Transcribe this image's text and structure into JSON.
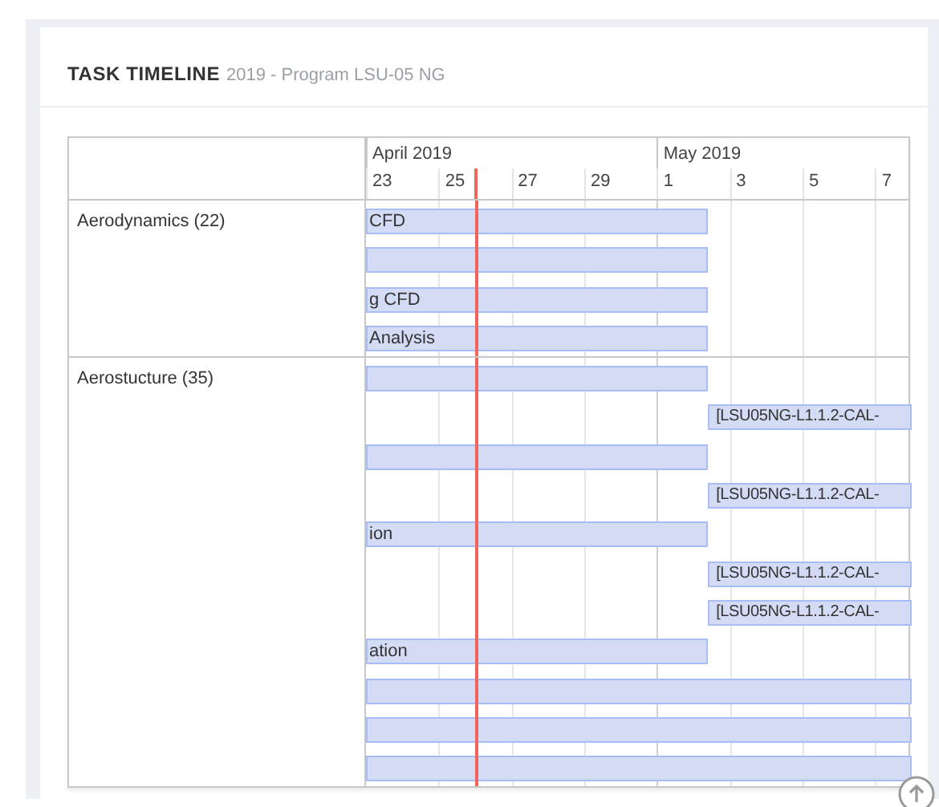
{
  "card": {
    "title": "TASK TIMELINE",
    "subtitle": "2019 - Program LSU-05 NG"
  },
  "timeline": {
    "months": [
      {
        "label": "April 2019",
        "days": [
          {
            "label": "23",
            "today": false
          },
          {
            "label": "25",
            "today": true
          },
          {
            "label": "27",
            "today": false
          },
          {
            "label": "29",
            "today": false
          }
        ]
      },
      {
        "label": "May 2019",
        "days": [
          {
            "label": "1",
            "today": false
          },
          {
            "label": "3",
            "today": false
          },
          {
            "label": "5",
            "today": false
          },
          {
            "label": "7",
            "today": false
          }
        ]
      }
    ],
    "groups": [
      {
        "label": "Aerodynamics (22)",
        "tasks": [
          {
            "kind": "early",
            "text": "CFD"
          },
          {
            "kind": "early"
          },
          {
            "kind": "early",
            "text": "g CFD"
          },
          {
            "kind": "early",
            "text": "Analysis"
          }
        ]
      },
      {
        "label": "Aerostucture (35)",
        "tasks": [
          {
            "kind": "early"
          },
          {
            "kind": "late",
            "text": "[LSU05NG-L1.1.2-CAL-"
          },
          {
            "kind": "early"
          },
          {
            "kind": "late",
            "text": "[LSU05NG-L1.1.2-CAL-"
          },
          {
            "kind": "early",
            "text": "ion"
          },
          {
            "kind": "late",
            "text": "[LSU05NG-L1.1.2-CAL-"
          },
          {
            "kind": "late",
            "text": "[LSU05NG-L1.1.2-CAL-"
          },
          {
            "kind": "early",
            "text": "ation"
          },
          {
            "kind": "long"
          },
          {
            "kind": "long"
          },
          {
            "kind": "long"
          }
        ]
      }
    ]
  }
}
